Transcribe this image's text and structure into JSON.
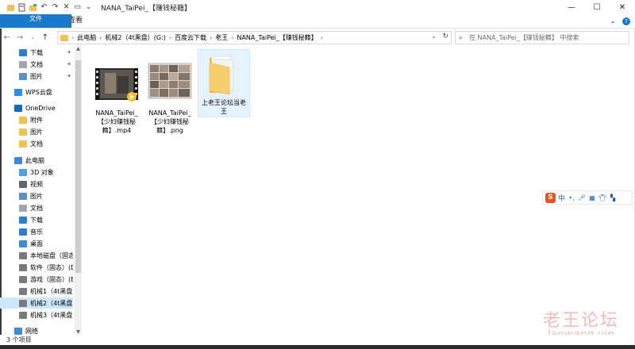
{
  "window": {
    "title": "NANA_TaiPei_【赚钱秘籍】",
    "controls": {
      "minimize": "—",
      "maximize": "☐",
      "close": "✕"
    }
  },
  "ribbon": {
    "tabs": [
      "文件",
      "主页",
      "共享",
      "查看"
    ],
    "expand_glyph": "⌄",
    "help_glyph": "?"
  },
  "address": {
    "crumbs": [
      "此电脑",
      "机械2（4t黑盘）(G:)",
      "百度云下载",
      "老王",
      "NANA_TaiPei_【赚钱秘籍】"
    ],
    "separator": "›"
  },
  "search": {
    "placeholder": "在 NANA_TaiPei_【赚钱秘籍】 中搜索"
  },
  "sidebar": {
    "items": [
      {
        "label": "下载",
        "icon": "download-arrow-icon",
        "color": "#2a7fd4",
        "pinned": true
      },
      {
        "label": "文档",
        "icon": "document-icon",
        "color": "#9aa7b3",
        "pinned": true
      },
      {
        "label": "图片",
        "icon": "pictures-icon",
        "color": "#5a8fc8",
        "pinned": true
      },
      {
        "label": "WPS云盘",
        "icon": "cloud-icon",
        "color": "#2d8cf0",
        "pinned": false
      },
      {
        "label": "OneDrive",
        "icon": "onedrive-cloud-icon",
        "color": "#0f6cbd",
        "pinned": false
      },
      {
        "label": "附件",
        "icon": "folder-icon",
        "color": "#f0c350",
        "pinned": false
      },
      {
        "label": "图片",
        "icon": "folder-icon",
        "color": "#f0c350",
        "pinned": false
      },
      {
        "label": "文档",
        "icon": "folder-icon",
        "color": "#f0c350",
        "pinned": false
      },
      {
        "label": "此电脑",
        "icon": "computer-icon",
        "color": "#3d8ad6",
        "pinned": false
      },
      {
        "label": "3D 对象",
        "icon": "3d-objects-icon",
        "color": "#4aa0e8",
        "pinned": false
      },
      {
        "label": "视频",
        "icon": "video-icon",
        "color": "#5b6670",
        "pinned": false
      },
      {
        "label": "图片",
        "icon": "pictures-icon",
        "color": "#5a8fc8",
        "pinned": false
      },
      {
        "label": "文档",
        "icon": "document-icon",
        "color": "#9aa7b3",
        "pinned": false
      },
      {
        "label": "下载",
        "icon": "download-arrow-icon",
        "color": "#2a7fd4",
        "pinned": false
      },
      {
        "label": "音乐",
        "icon": "music-icon",
        "color": "#2a7fd4",
        "pinned": false
      },
      {
        "label": "桌面",
        "icon": "desktop-icon",
        "color": "#3d8ad6",
        "pinned": false
      },
      {
        "label": "本地磁盘（固态",
        "icon": "drive-icon",
        "color": "#7a7a7a",
        "pinned": false
      },
      {
        "label": "软件（固态）(D",
        "icon": "drive-icon",
        "color": "#7a7a7a",
        "pinned": false
      },
      {
        "label": "游戏（固态）(E",
        "icon": "drive-icon",
        "color": "#7a7a7a",
        "pinned": false
      },
      {
        "label": "机械1（4t黑盘",
        "icon": "drive-icon",
        "color": "#7a7a7a",
        "pinned": false
      },
      {
        "label": "机械2（4t黑盘）",
        "icon": "drive-icon",
        "color": "#7a7a7a",
        "pinned": false,
        "selected": true
      },
      {
        "label": "机械3（4t黑盘",
        "icon": "drive-icon",
        "color": "#7a7a7a",
        "pinned": false
      },
      {
        "label": "网络",
        "icon": "network-icon",
        "color": "#3d8ad6",
        "pinned": false
      }
    ]
  },
  "files": [
    {
      "name": "NANA_TaiPei_【少妇赚钱秘籍】.mp4",
      "type": "video"
    },
    {
      "name": "NANA_TaiPei_【少妇赚钱秘籍】.png",
      "type": "image"
    },
    {
      "name": "上老王论坛当老王",
      "type": "folder"
    }
  ],
  "status": {
    "count_text": "3 个项目"
  },
  "ime": {
    "logo_char": "S",
    "lang": "中"
  },
  "watermark": {
    "line1": "老王论坛",
    "line2": "laowang.vip"
  }
}
